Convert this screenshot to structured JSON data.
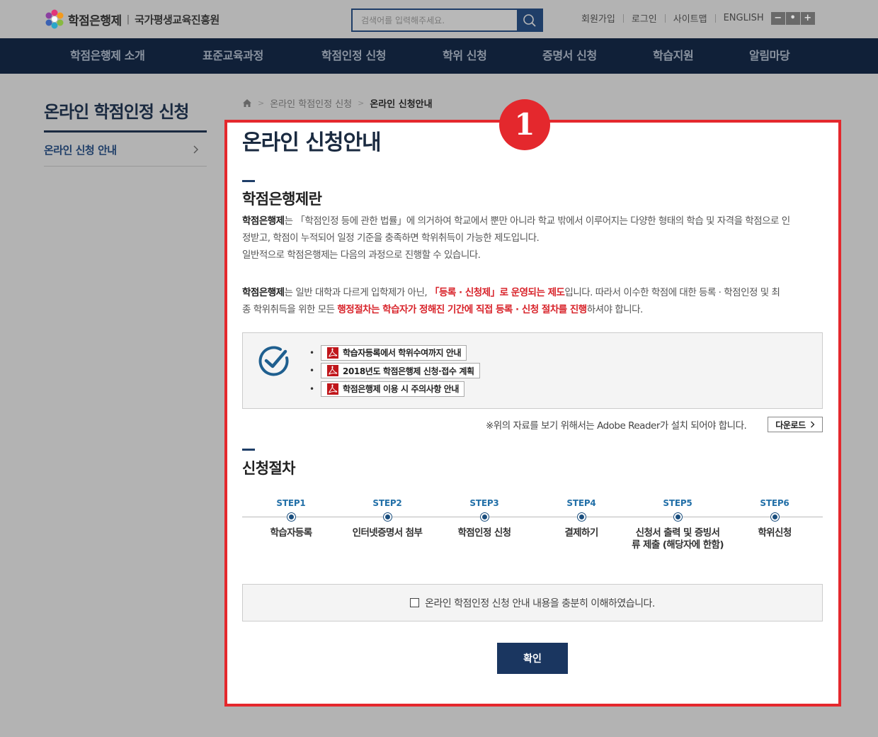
{
  "header": {
    "logo_main": "학점은행제",
    "logo_sep": "|",
    "logo_sub": "국가평생교육진흥원",
    "search_placeholder": "검색어를 입력해주세요.",
    "util_links": [
      "회원가입",
      "로그인",
      "사이트맵",
      "ENGLISH"
    ],
    "zoom_buttons": [
      "−",
      "•",
      "+"
    ]
  },
  "gnb": [
    "학점은행제 소개",
    "표준교육과정",
    "학점인정 신청",
    "학위 신청",
    "증명서 신청",
    "학습지원",
    "알림마당"
  ],
  "lnb": {
    "title": "온라인 학점인정 신청",
    "item": "온라인 신청 안내"
  },
  "breadcrumb": {
    "level1": "온라인 학점인정 신청",
    "current": "온라인 신청안내"
  },
  "badge": "1",
  "page_title": "온라인 신청안내",
  "section1": {
    "title": "학점은행제란",
    "p1_bold": "학점은행제",
    "p1_line1_rest": "는 「학점인정 등에 관한 법률」에 의거하여 학교에서 뿐만 아니라 학교 밖에서 이루어지는 다양한 형태의 학습 및 자격을 학점으로 인",
    "p1_line2": "정받고, 학점이 누적되어 일정 기준을 충족하면 학위취득이 가능한 제도입니다.",
    "p1_line3": "일반적으로 학점은행제는 다음의 과정으로 진행할 수 있습니다.",
    "p2_bold": "학점은행제",
    "p2_a": "는 일반 대학과 다르게 입학제가 아닌, ",
    "p2_red1": "「등록 · 신청제」로 운영되는 제도",
    "p2_b": "입니다. 따라서 이수한 학점에 대한 등록 · 학점인정 및 최",
    "p2_c": "종 학위취득을 위한 모든 ",
    "p2_red2": "행정절차는 학습자가 정해진 기간에 직접 등록 · 신청 절차를 진행",
    "p2_d": "하셔야 합니다."
  },
  "documents": [
    "학습자등록에서 학위수여까지 안내",
    "2018년도 학점은행제 신청·접수 계획",
    "학점은행제 이용 시 주의사항 안내"
  ],
  "adobe_note": "※위의 자료를 보기 위해서는 Adobe Reader가 설치 되어야 합니다.",
  "download_label": "다운로드",
  "section2": {
    "title": "신청절차",
    "steps": [
      {
        "no": "STEP1",
        "name": "학습자등록"
      },
      {
        "no": "STEP2",
        "name": "인터넷증명서 첨부"
      },
      {
        "no": "STEP3",
        "name": "학점인정 신청"
      },
      {
        "no": "STEP4",
        "name": "결제하기"
      },
      {
        "no": "STEP5",
        "name": "신청서 출력 및 증빙서류 제출 (해당자에 한함)"
      },
      {
        "no": "STEP6",
        "name": "학위신청"
      }
    ]
  },
  "agree_label": "온라인 학점인정 신청 안내 내용을 충분히 이해하였습니다.",
  "confirm_label": "확인"
}
